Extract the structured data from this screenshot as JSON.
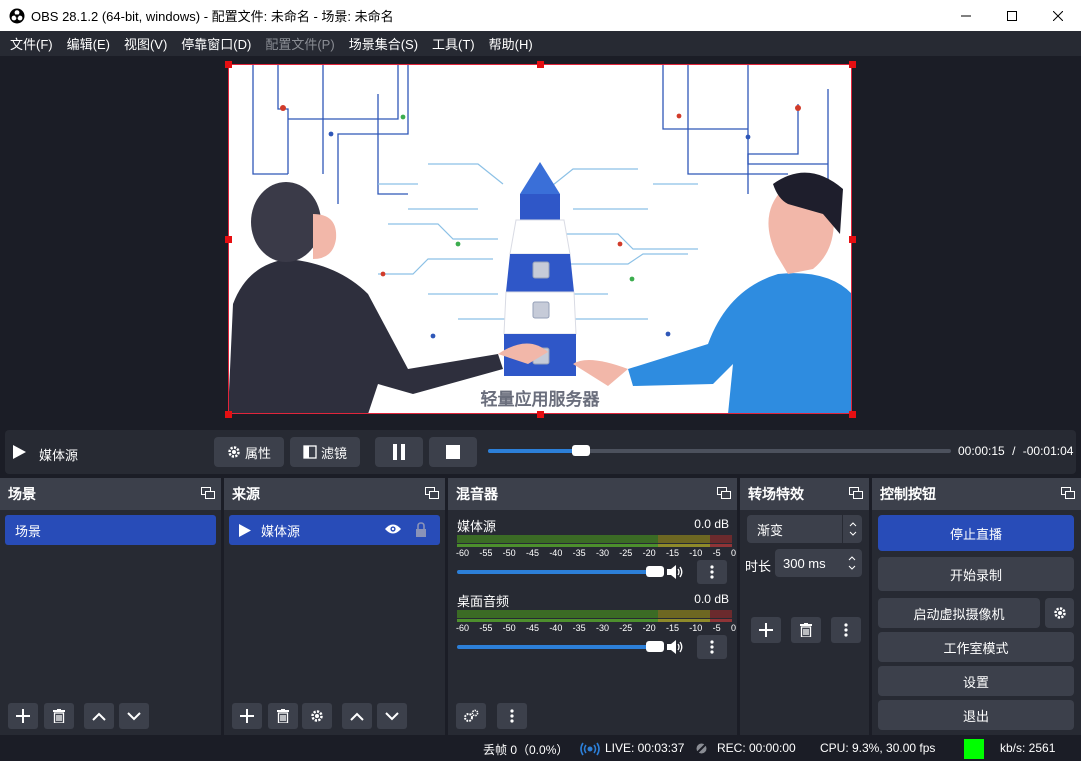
{
  "window": {
    "title": "OBS 28.1.2 (64-bit, windows) - 配置文件: 未命名 - 场景: 未命名"
  },
  "menu": [
    "文件(F)",
    "编辑(E)",
    "视图(V)",
    "停靠窗口(D)",
    "配置文件(P)",
    "场景集合(S)",
    "工具(T)",
    "帮助(H)"
  ],
  "preview": {
    "caption": "轻量应用服务器"
  },
  "media": {
    "source_name": "媒体源",
    "properties": "属性",
    "filters": "滤镜",
    "elapsed": "00:00:15",
    "separator": "/",
    "remaining": "-00:01:04",
    "progress": 0.2
  },
  "scenes": {
    "title": "场景",
    "items": [
      "场景"
    ]
  },
  "sources": {
    "title": "来源",
    "items": [
      "媒体源"
    ]
  },
  "mixer": {
    "title": "混音器",
    "scale": [
      "-60",
      "-55",
      "-50",
      "-45",
      "-40",
      "-35",
      "-30",
      "-25",
      "-20",
      "-15",
      "-10",
      "-5",
      "0"
    ],
    "channels": [
      {
        "name": "媒体源",
        "db": "0.0 dB"
      },
      {
        "name": "桌面音频",
        "db": "0.0 dB"
      }
    ]
  },
  "transitions": {
    "title": "转场特效",
    "selected": "渐变",
    "duration_label": "时长",
    "duration": "300 ms"
  },
  "controls": {
    "title": "控制按钮",
    "stop_stream": "停止直播",
    "start_record": "开始录制",
    "virtual_cam": "启动虚拟摄像机",
    "studio_mode": "工作室模式",
    "settings": "设置",
    "exit": "退出"
  },
  "status": {
    "dropped": "丢帧 0（0.0%）",
    "live": "LIVE: 00:03:37",
    "rec": "REC: 00:00:00",
    "cpu": "CPU: 9.3%, 30.00 fps",
    "kbps": "kb/s: 2561"
  },
  "colors": {
    "accent": "#284cb8",
    "panel": "#272a33",
    "header": "#3c404b",
    "bg": "#1b1d26",
    "live_green": "#00ff00",
    "selection": "#e1253b"
  }
}
